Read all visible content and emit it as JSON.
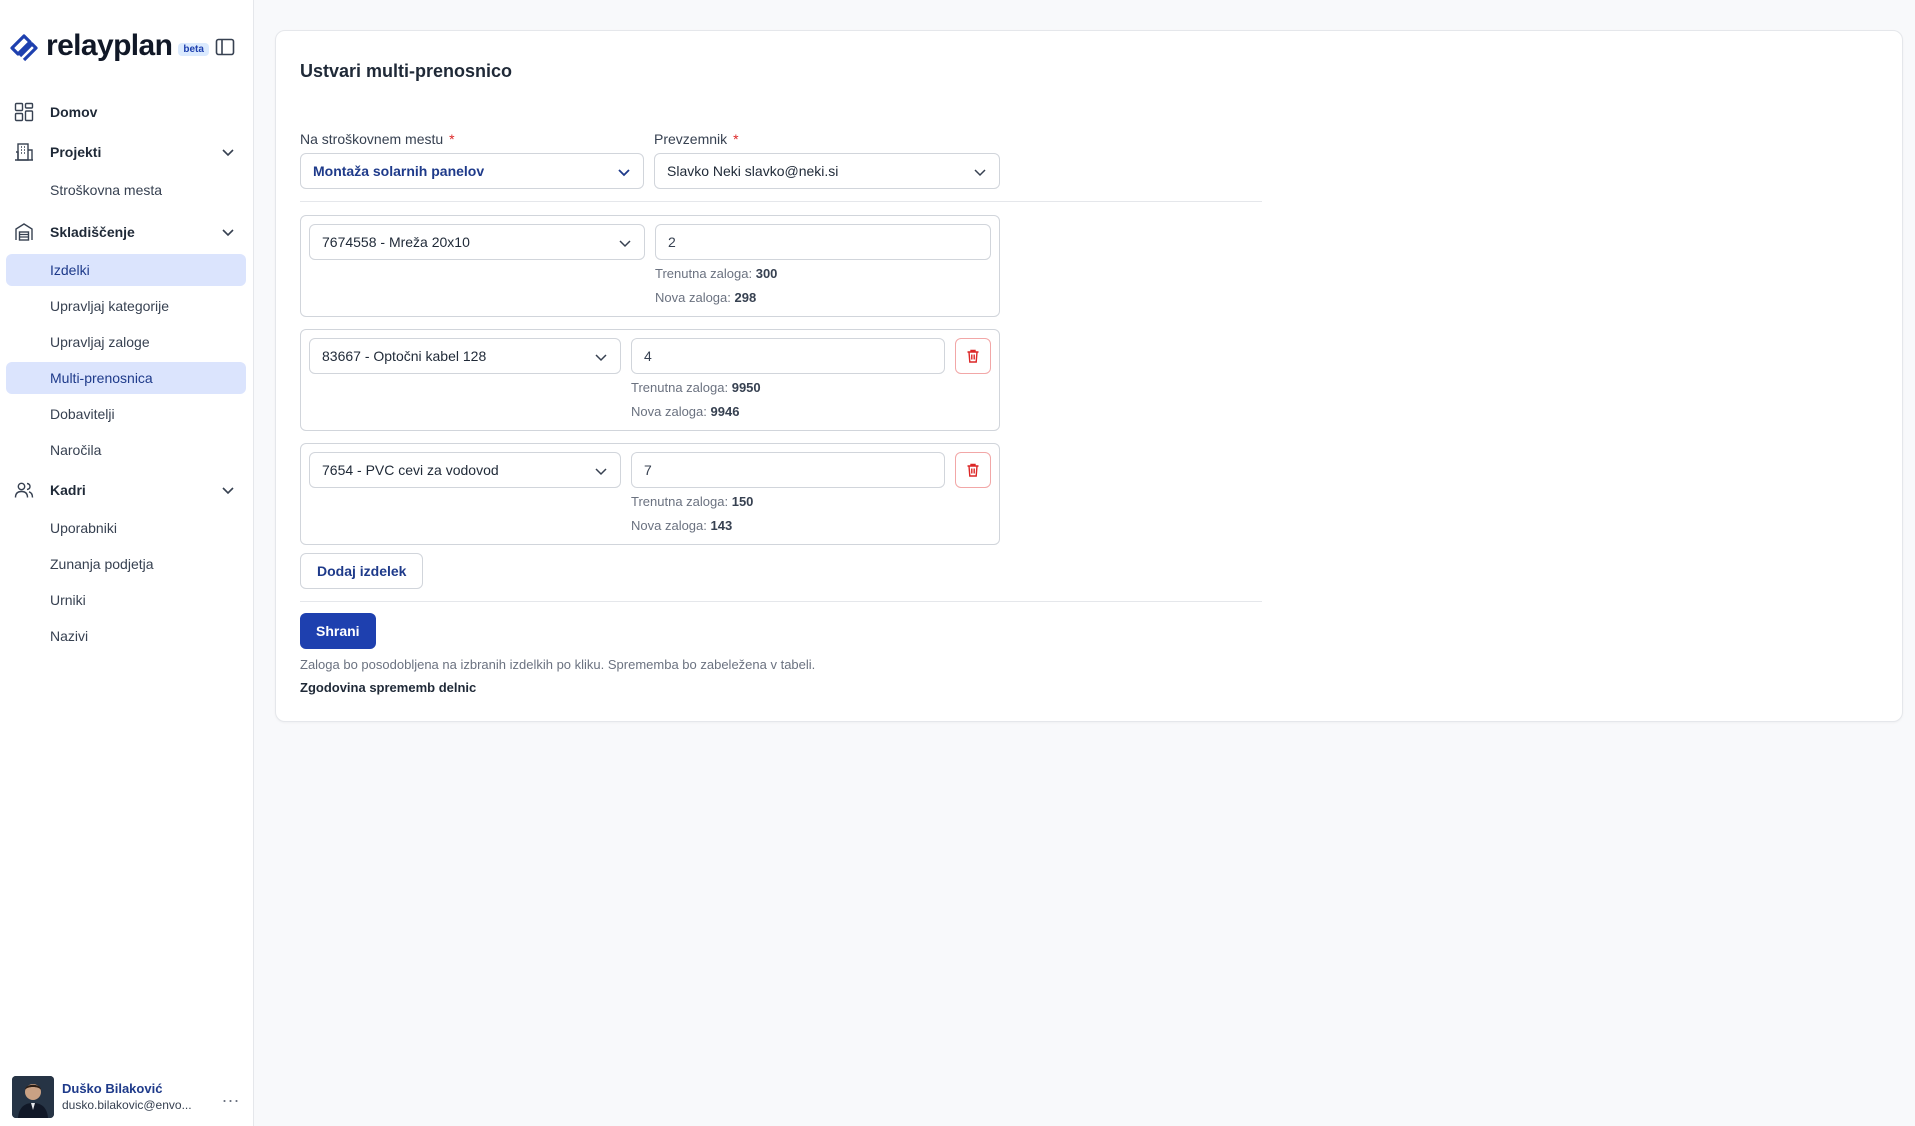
{
  "brand": {
    "name": "relayplan",
    "badge": "beta",
    "logo_icon": "relayplan-logo-icon",
    "accent": "#1e40af"
  },
  "sidebar": {
    "collapse_icon": "sidebar-toggle-icon",
    "home": {
      "label": "Domov",
      "icon": "grid-icon"
    },
    "groups": [
      {
        "label": "Projekti",
        "icon": "building-icon",
        "items": [
          "Stroškovna mesta"
        ]
      },
      {
        "label": "Skladiščenje",
        "icon": "warehouse-icon",
        "items": [
          "Izdelki",
          "Upravljaj kategorije",
          "Upravljaj zaloge",
          "Multi-prenosnica",
          "Dobavitelji",
          "Naročila"
        ]
      },
      {
        "label": "Kadri",
        "icon": "users-icon",
        "items": [
          "Uporabniki",
          "Zunanja podjetja",
          "Urniki",
          "Nazivi"
        ]
      }
    ]
  },
  "user": {
    "name": "Duško Bilaković",
    "email": "dusko.bilakovic@envo...",
    "more": "..."
  },
  "form": {
    "title": "Ustvari multi-prenosnico",
    "cost_center": {
      "label": "Na stroškovnem mestu",
      "required": "*",
      "value": "Montaža solarnih panelov"
    },
    "receiver": {
      "label": "Prevzemnik",
      "required": "*",
      "value": "Slavko Neki slavko@neki.si"
    },
    "items": [
      {
        "product": "7674558 - Mreža 20x10",
        "quantity": "2",
        "current_label": "Trenutna zaloga:",
        "current": "300",
        "new_label": "Nova zaloga:",
        "new": "298"
      },
      {
        "product": "83667 - Optočni kabel 128",
        "quantity": "4",
        "current_label": "Trenutna zaloga:",
        "current": "9950",
        "new_label": "Nova zaloga:",
        "new": "9946"
      },
      {
        "product": "7654 - PVC cevi za vodovod",
        "quantity": "7",
        "current_label": "Trenutna zaloga:",
        "current": "150",
        "new_label": "Nova zaloga:",
        "new": "143"
      }
    ],
    "add_item_label": "Dodaj izdelek",
    "save_label": "Shrani",
    "note": "Zaloga bo posodobljena na izbranih izdelkih po kliku. Sprememba bo zabeležena v tabeli.",
    "history_link": "Zgodovina sprememb delnic"
  }
}
